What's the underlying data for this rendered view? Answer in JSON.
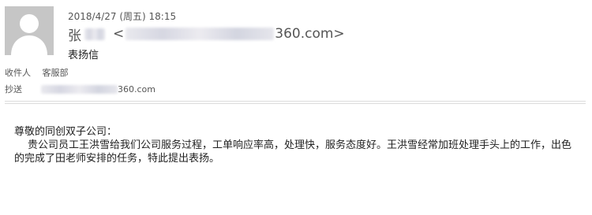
{
  "header": {
    "datetime": "2018/4/27 (周五) 18:15",
    "sender_name": "张",
    "sender_email_open": "<",
    "sender_email_visible": "360.com>",
    "subject": "表扬信"
  },
  "recipients": {
    "to_label": "收件人",
    "to_value": "客服部",
    "cc_label": "抄送",
    "cc_visible": "360.com"
  },
  "body": {
    "greeting": "尊敬的同创双子公司：",
    "paragraph": "贵公司员工王洪雪给我们公司服务过程，工单响应率高，处理快，服务态度好。王洪雪经常加班处理手头上的工作，出色的完成了田老师安排的任务，特此提出表扬。"
  },
  "icons": {
    "avatar": "user-silhouette-icon"
  },
  "colors": {
    "avatar_bg": "#c6c6c6",
    "avatar_figure": "#ffffff",
    "divider": "#dcdcdc"
  }
}
